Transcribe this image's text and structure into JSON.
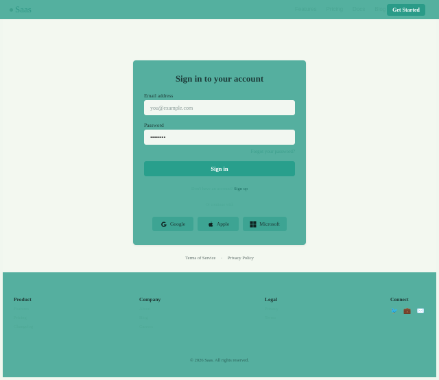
{
  "header": {
    "brand": "Saas",
    "nav": [
      "Features",
      "Pricing",
      "Docs",
      "Blog"
    ],
    "cta": "Get Started"
  },
  "card": {
    "title": "Sign in to your account",
    "email_label": "Email address",
    "email_placeholder": "you@example.com",
    "password_label": "Password",
    "password_value": "••••••••",
    "forgot": "Forgot your password?",
    "signin": "Sign in",
    "no_account": "Don't have an account?",
    "signup": "Sign up",
    "divider": "Or continue with",
    "social": [
      "Google",
      "Apple",
      "Microsoft"
    ]
  },
  "legal": {
    "terms": "Terms of Service",
    "privacy": "Privacy Policy"
  },
  "footer": {
    "columns": [
      {
        "title": "Product",
        "links": [
          "Features",
          "Pricing",
          "Changelog"
        ]
      },
      {
        "title": "Company",
        "links": [
          "About",
          "Blog",
          "Careers"
        ]
      },
      {
        "title": "Legal",
        "links": [
          "Privacy",
          "Terms"
        ]
      },
      {
        "title": "Connect",
        "links": []
      }
    ],
    "icons": [
      "twitter-icon",
      "briefcase-icon",
      "mail-icon"
    ],
    "copyright": "© 2026 Saas. All rights reserved."
  }
}
